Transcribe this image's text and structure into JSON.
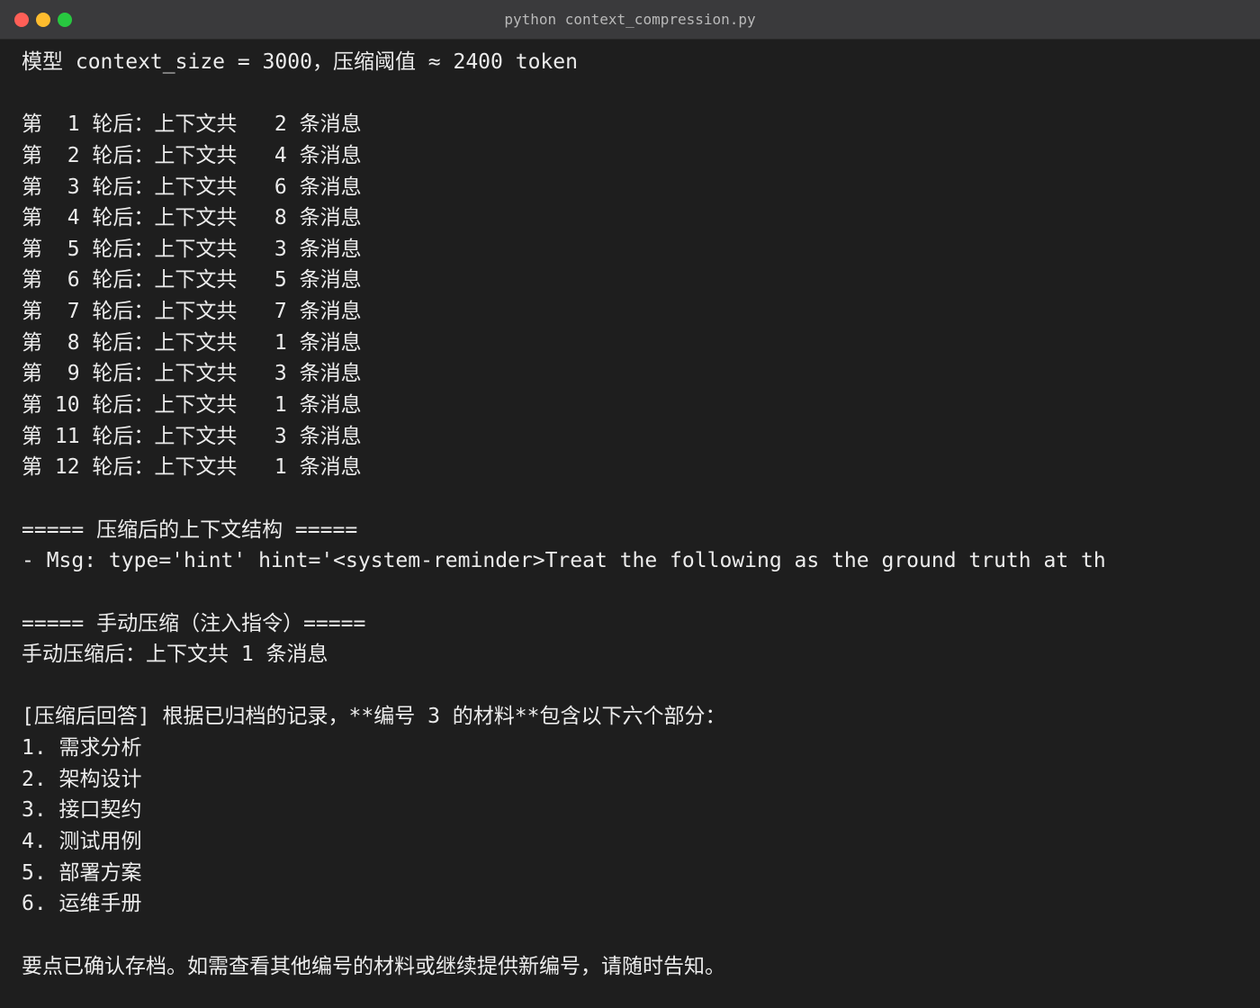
{
  "window": {
    "title": "python context_compression.py"
  },
  "terminal": {
    "lines": [
      "模型 context_size = 3000，压缩阈值 ≈ 2400 token",
      "",
      "第  1 轮后：上下文共   2 条消息",
      "第  2 轮后：上下文共   4 条消息",
      "第  3 轮后：上下文共   6 条消息",
      "第  4 轮后：上下文共   8 条消息",
      "第  5 轮后：上下文共   3 条消息",
      "第  6 轮后：上下文共   5 条消息",
      "第  7 轮后：上下文共   7 条消息",
      "第  8 轮后：上下文共   1 条消息",
      "第  9 轮后：上下文共   3 条消息",
      "第 10 轮后：上下文共   1 条消息",
      "第 11 轮后：上下文共   3 条消息",
      "第 12 轮后：上下文共   1 条消息",
      "",
      "===== 压缩后的上下文结构 =====",
      "- Msg: type='hint' hint='<system-reminder>Treat the following as the ground truth at th",
      "",
      "===== 手动压缩（注入指令）=====",
      "手动压缩后：上下文共 1 条消息",
      "",
      "[压缩后回答] 根据已归档的记录，**编号 3 的材料**包含以下六个部分：",
      "1. 需求分析",
      "2. 架构设计",
      "3. 接口契约",
      "4. 测试用例",
      "5. 部署方案",
      "6. 运维手册",
      "",
      "要点已确认存档。如需查看其他编号的材料或继续提供新编号，请随时告知。"
    ]
  }
}
